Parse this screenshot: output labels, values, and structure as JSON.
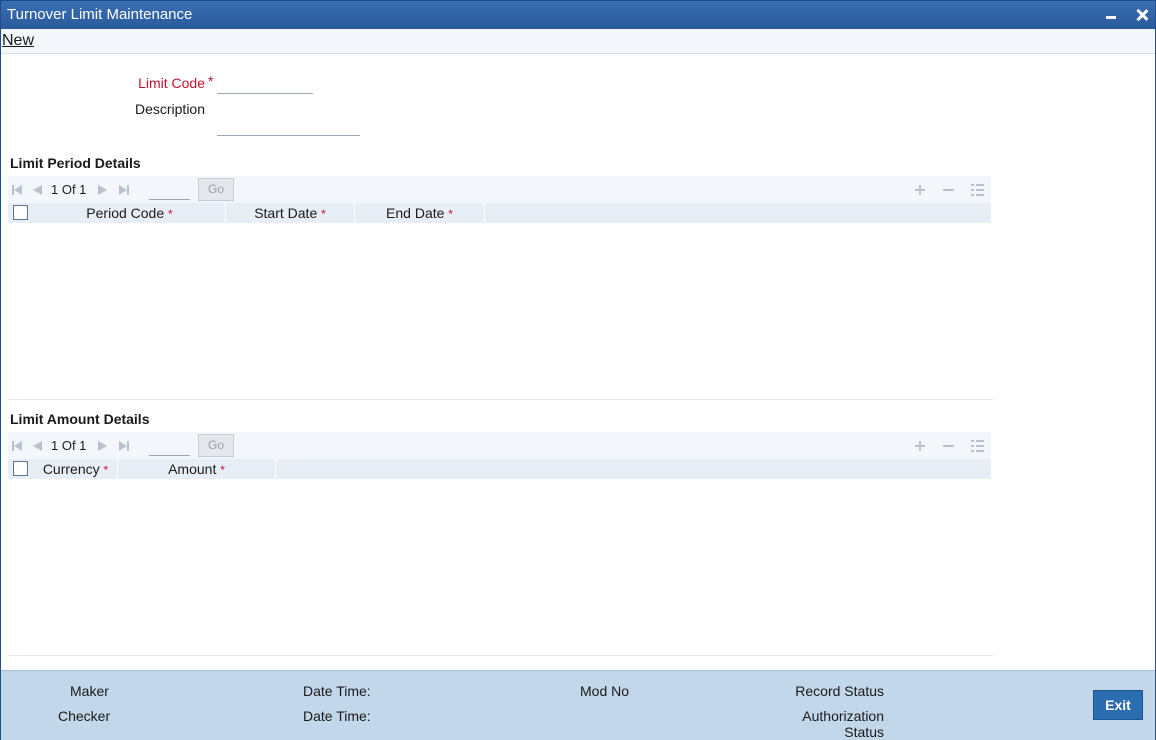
{
  "window": {
    "title": "Turnover Limit Maintenance"
  },
  "toolbar": {
    "new_label": "New"
  },
  "header": {
    "limit_code_label": "Limit Code",
    "limit_code_value": "",
    "description_label": "Description",
    "description_value": "",
    "required_mark": "*"
  },
  "period_section": {
    "title": "Limit Period Details",
    "pager_text": "1 Of 1",
    "go_label": "Go",
    "columns": [
      {
        "label": "Period Code",
        "required": "*"
      },
      {
        "label": "Start Date",
        "required": "*"
      },
      {
        "label": "End Date",
        "required": "*"
      }
    ]
  },
  "amount_section": {
    "title": "Limit Amount Details",
    "pager_text": "1 Of 1",
    "go_label": "Go",
    "columns": [
      {
        "label": "Currency",
        "required": "*"
      },
      {
        "label": "Amount",
        "required": "*"
      }
    ]
  },
  "footer": {
    "maker_label": "Maker",
    "checker_label": "Checker",
    "date_time_label": "Date Time:",
    "mod_no_label": "Mod No",
    "record_status_label": "Record Status",
    "authorization_status_line1": "Authorization",
    "authorization_status_line2": "Status",
    "exit_label": "Exit"
  },
  "colors": {
    "title_bar": "#2a5a9c",
    "required": "#c4122f",
    "footer_bg": "#c3d7ea",
    "exit_button": "#2a6db0"
  }
}
